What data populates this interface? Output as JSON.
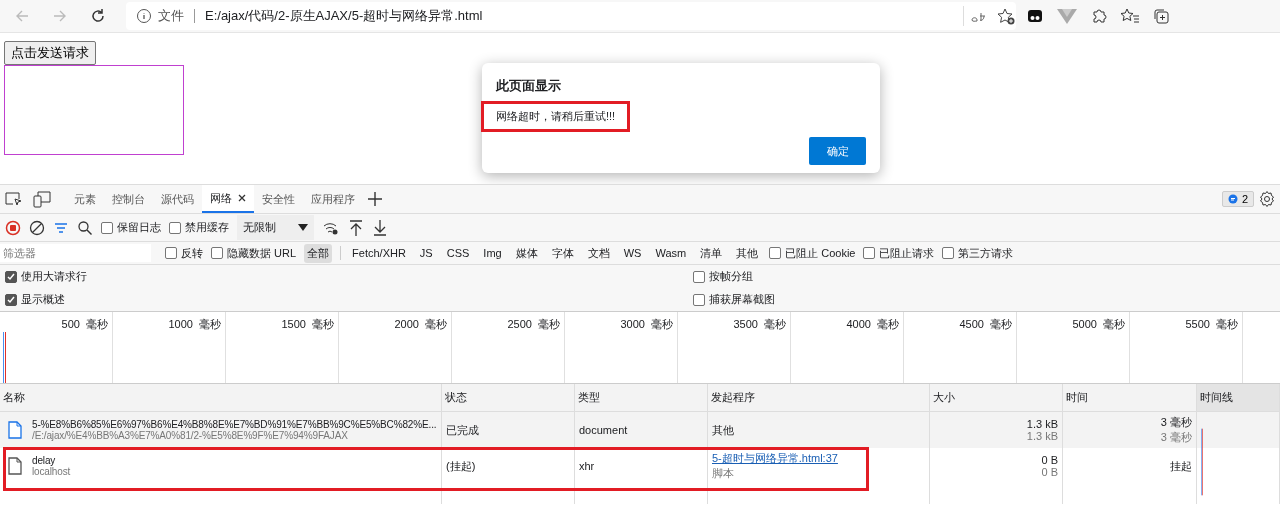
{
  "browser": {
    "address_prefix": "文件",
    "url": "E:/ajax/代码/2-原生AJAX/5-超时与网络异常.html"
  },
  "page": {
    "button": "点击发送请求"
  },
  "dialog": {
    "title": "此页面显示",
    "message": "网络超时，请稍后重试!!!",
    "message_highlighted": true,
    "ok_button": "确定"
  },
  "devtools": {
    "tabs": [
      {
        "label": "元素",
        "selected": false
      },
      {
        "label": "控制台",
        "selected": false
      },
      {
        "label": "源代码",
        "selected": false
      },
      {
        "label": "网络",
        "selected": true
      },
      {
        "label": "安全性",
        "selected": false
      },
      {
        "label": "应用程序",
        "selected": false
      }
    ],
    "issues_count": "2",
    "toolbar": {
      "recording": true,
      "options": [
        {
          "label": "保留日志",
          "checked": false
        },
        {
          "label": "禁用缓存",
          "checked": false
        }
      ],
      "throttling": "无限制"
    },
    "filter": {
      "placeholder": "筛选器",
      "options": [
        {
          "label": "反转",
          "checked": false
        },
        {
          "label": "隐藏数据 URL",
          "checked": false
        }
      ],
      "types": [
        {
          "label": "全部",
          "selected": true
        },
        {
          "label": "Fetch/XHR",
          "selected": false
        },
        {
          "label": "JS",
          "selected": false
        },
        {
          "label": "CSS",
          "selected": false
        },
        {
          "label": "Img",
          "selected": false
        },
        {
          "label": "媒体",
          "selected": false
        },
        {
          "label": "字体",
          "selected": false
        },
        {
          "label": "文档",
          "selected": false
        },
        {
          "label": "WS",
          "selected": false
        },
        {
          "label": "Wasm",
          "selected": false
        },
        {
          "label": "清单",
          "selected": false
        },
        {
          "label": "其他",
          "selected": false
        }
      ],
      "extra_options": [
        {
          "label": "已阻止 Cookie",
          "checked": false
        },
        {
          "label": "已阻止请求",
          "checked": false
        },
        {
          "label": "第三方请求",
          "checked": false
        }
      ]
    },
    "settings_left": [
      {
        "label": "使用大请求行",
        "checked": true
      },
      {
        "label": "显示概述",
        "checked": true
      }
    ],
    "settings_right": [
      {
        "label": "按帧分组",
        "checked": false
      },
      {
        "label": "捕获屏幕截图",
        "checked": false
      }
    ],
    "overview_ticks": [
      "500  毫秒",
      "1000  毫秒",
      "1500  毫秒",
      "2000  毫秒",
      "2500  毫秒",
      "3000  毫秒",
      "3500  毫秒",
      "4000  毫秒",
      "4500  毫秒",
      "5000  毫秒",
      "5500  毫秒"
    ],
    "columns": [
      "名称",
      "状态",
      "类型",
      "发起程序",
      "大小",
      "时间",
      "时间线"
    ],
    "rows": [
      {
        "kind": "document",
        "name": "5-%E8%B6%85%E6%97%B6%E4%B8%8E%E7%BD%91%E7%BB%9C%E5%BC%82%E...",
        "path": "/E:/ajax/%E4%BB%A3%E7%A0%81/2-%E5%8E%9F%E7%94%9FAJAX",
        "status": "已完成",
        "type": "document",
        "initiator": "其他",
        "initiator_is_link": false,
        "size": "1.3 kB",
        "size_sub": "1.3 kB",
        "time": "3  毫秒",
        "time_sub": "3  毫秒",
        "highlighted": false
      },
      {
        "kind": "file",
        "name": "delay",
        "path": "localhost",
        "status": "(挂起)",
        "type": "xhr",
        "initiator": "5-超时与网络异常.html:37",
        "initiator_is_link": true,
        "initiator_sub": "脚本",
        "size": "0 B",
        "size_sub": "0 B",
        "time": "挂起",
        "highlighted": true
      }
    ]
  }
}
